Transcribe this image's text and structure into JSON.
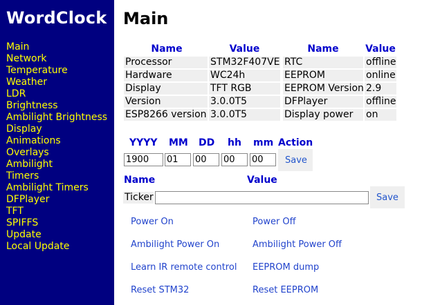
{
  "app_title": "WordClock",
  "nav": [
    "Main",
    "Network",
    "Temperature",
    "Weather",
    "LDR",
    "Brightness",
    "Ambilight Brightness",
    "Display",
    "Animations",
    "Overlays",
    "Ambilight",
    "Timers",
    "Ambilight Timers",
    "DFPlayer",
    "TFT",
    "SPIFFS",
    "Update",
    "Local Update"
  ],
  "page_title": "Main",
  "info_table": {
    "headers": [
      "Name",
      "Value",
      "Name",
      "Value"
    ],
    "rows": [
      [
        "Processor",
        "STM32F407VE",
        "RTC",
        "offline"
      ],
      [
        "Hardware",
        "WC24h",
        "EEPROM",
        "online"
      ],
      [
        "Display",
        "TFT RGB",
        "EEPROM Version",
        "2.9"
      ],
      [
        "Version",
        "3.0.0T5",
        "DFPlayer",
        "offline"
      ],
      [
        "ESP8266 version",
        "3.0.0T5",
        "Display power",
        "on"
      ]
    ]
  },
  "datetime": {
    "headers": [
      "YYYY",
      "MM",
      "DD",
      "hh",
      "mm",
      "Action"
    ],
    "values": [
      "1900",
      "01",
      "00",
      "00",
      "00"
    ],
    "save": "Save"
  },
  "ticker": {
    "headers": [
      "Name",
      "Value"
    ],
    "label": "Ticker",
    "value": "",
    "save": "Save"
  },
  "commands": [
    [
      "Power On",
      "Power Off"
    ],
    [
      "Ambilight Power On",
      "Ambilight Power Off"
    ],
    [
      "Learn IR remote control",
      "EEPROM dump"
    ],
    [
      "Reset STM32",
      "Reset EEPROM"
    ]
  ],
  "colors": {
    "sidebar_bg": "#000080",
    "nav_text": "#ffff00",
    "header_blue": "#0000cc",
    "link_blue": "#2244cc",
    "cell_bg": "#efefef"
  }
}
